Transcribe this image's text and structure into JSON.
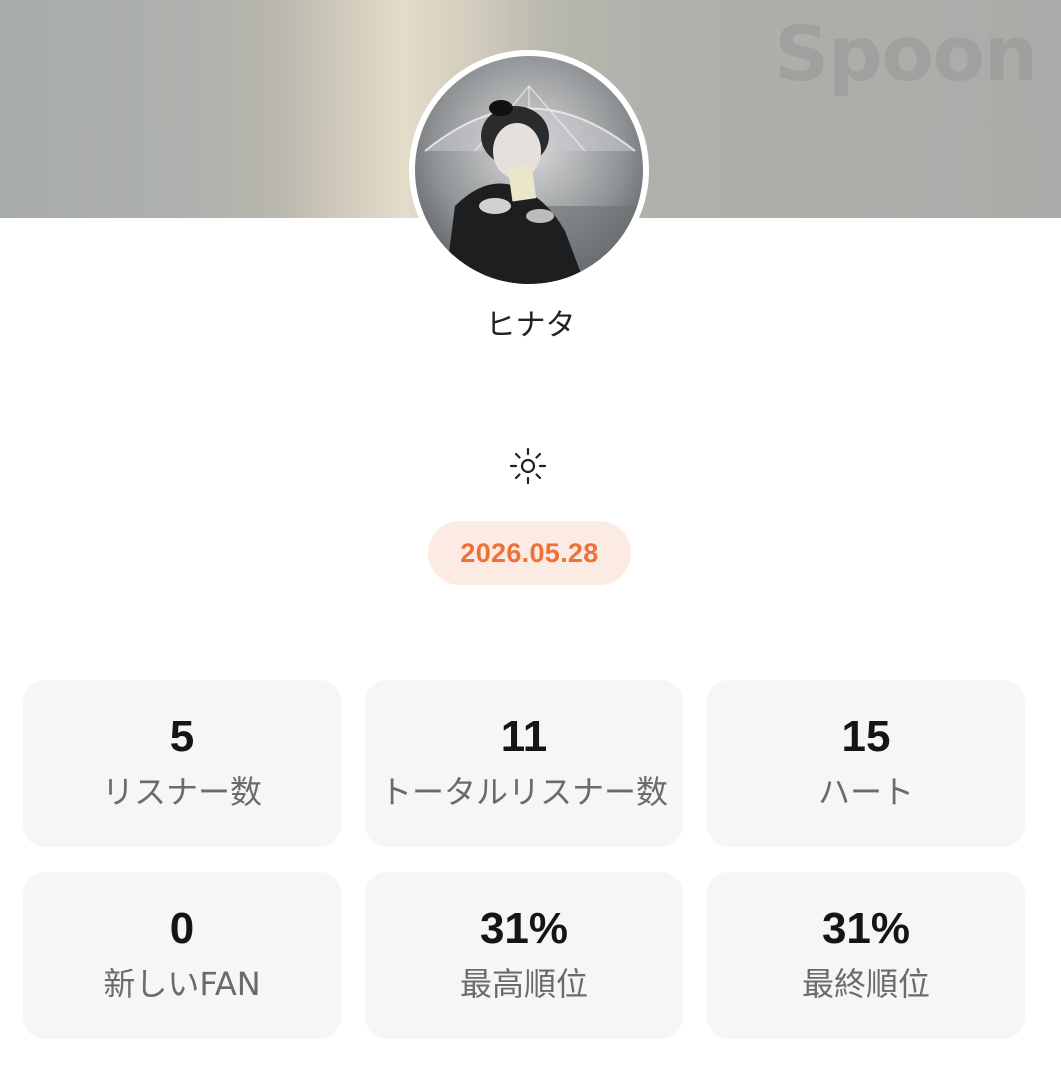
{
  "header": {
    "brand": "Spoon",
    "avatar_icon": "profile-photo"
  },
  "profile": {
    "username": "ヒナタ",
    "status_icon": "sun-icon"
  },
  "date_badge": {
    "text": "2026.05.28",
    "color": "#ee7138",
    "background": "#fcebe2"
  },
  "stats": [
    {
      "value": "5",
      "label": "リスナー数"
    },
    {
      "value": "11",
      "label": "トータルリスナー数"
    },
    {
      "value": "15",
      "label": "ハート"
    },
    {
      "value": "0",
      "label": "新しいFAN"
    },
    {
      "value": "31%",
      "label": "最高順位"
    },
    {
      "value": "31%",
      "label": "最終順位"
    }
  ]
}
